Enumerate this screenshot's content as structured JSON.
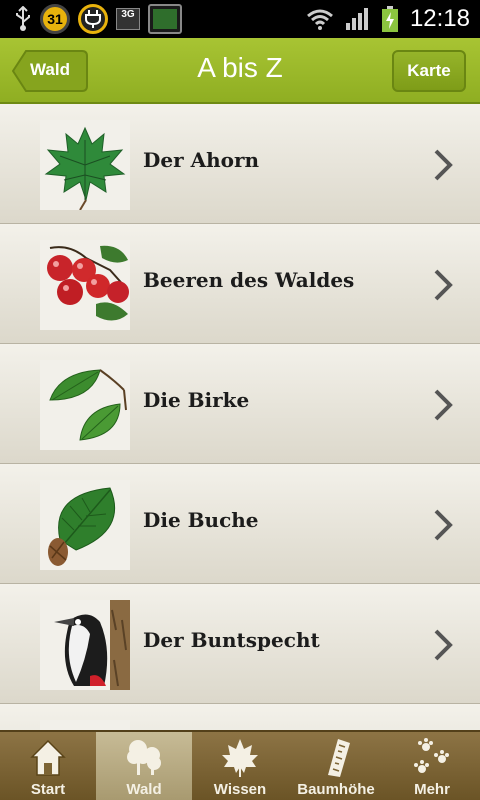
{
  "status_bar": {
    "time": "12:18",
    "calendar_day": "31",
    "network": "3G"
  },
  "header": {
    "title": "A bis Z",
    "back_label": "Wald",
    "map_label": "Karte"
  },
  "list": {
    "items": [
      {
        "label": "Der Ahorn",
        "icon": "maple-leaf-icon"
      },
      {
        "label": "Beeren des Waldes",
        "icon": "berries-icon"
      },
      {
        "label": "Die Birke",
        "icon": "birch-leaves-icon"
      },
      {
        "label": "Die Buche",
        "icon": "beech-leaf-icon"
      },
      {
        "label": "Der Buntspecht",
        "icon": "woodpecker-icon"
      }
    ]
  },
  "tabbar": {
    "tabs": [
      {
        "label": "Start",
        "icon": "house-icon"
      },
      {
        "label": "Wald",
        "icon": "trees-icon",
        "active": true
      },
      {
        "label": "Wissen",
        "icon": "maple-leaf-icon"
      },
      {
        "label": "Baumhöhe",
        "icon": "ruler-icon"
      },
      {
        "label": "Mehr",
        "icon": "paw-prints-icon"
      }
    ]
  },
  "colors": {
    "header": "#9cba2c",
    "tabbar": "#7c6434",
    "active_tab": "#b8ab82",
    "row": "#e9e6dc"
  }
}
